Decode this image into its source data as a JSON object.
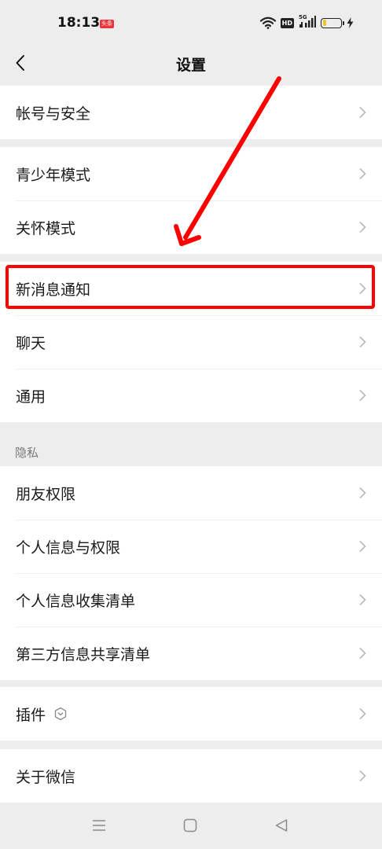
{
  "status_bar": {
    "time": "18:13",
    "badge": "头条",
    "hd": "HD",
    "network": "5G",
    "battery_level": 0.3,
    "battery_color": "#f5c322"
  },
  "header": {
    "title": "设置",
    "back_icon": "chevron-left-icon"
  },
  "groups": [
    {
      "items": [
        {
          "label": "帐号与安全"
        }
      ]
    },
    {
      "items": [
        {
          "label": "青少年模式"
        },
        {
          "label": "关怀模式"
        }
      ]
    },
    {
      "items": [
        {
          "label": "新消息通知",
          "highlighted": true
        },
        {
          "label": "聊天"
        },
        {
          "label": "通用"
        }
      ]
    },
    {
      "header": "隐私",
      "items": [
        {
          "label": "朋友权限"
        },
        {
          "label": "个人信息与权限"
        },
        {
          "label": "个人信息收集清单"
        },
        {
          "label": "第三方信息共享清单"
        }
      ]
    },
    {
      "items": [
        {
          "label": "插件",
          "icon": "plugin-icon"
        }
      ]
    },
    {
      "items": [
        {
          "label": "关于微信"
        }
      ]
    }
  ],
  "annotation": {
    "color": "#ff0000",
    "arrow_icon": "red-arrow",
    "target": "新消息通知"
  },
  "system_nav": {
    "icons": [
      "menu-icon",
      "home-icon",
      "back-icon"
    ]
  }
}
